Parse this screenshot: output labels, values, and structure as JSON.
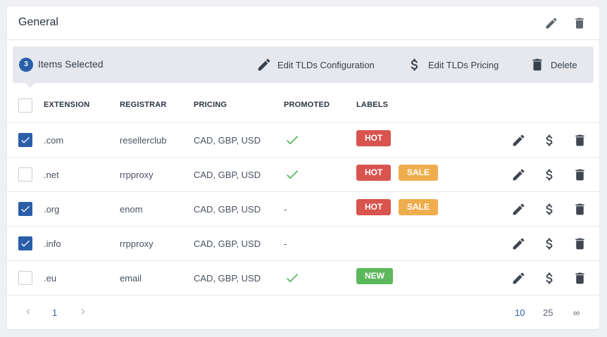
{
  "header": {
    "title": "General"
  },
  "bulk": {
    "count": "3",
    "label": "Items Selected",
    "edit_config": "Edit TLDs Configuration",
    "edit_pricing": "Edit TLDs Pricing",
    "delete": "Delete"
  },
  "columns": {
    "extension": "EXTENSION",
    "registrar": "REGISTRAR",
    "pricing": "PRICING",
    "promoted": "PROMOTED",
    "labels": "LABELS"
  },
  "rows": [
    {
      "extension": ".com",
      "registrar": "resellerclub",
      "pricing": "CAD, GBP, USD",
      "promoted": true,
      "checked": true,
      "labels": [
        "HOT"
      ]
    },
    {
      "extension": ".net",
      "registrar": "rrpproxy",
      "pricing": "CAD, GBP, USD",
      "promoted": true,
      "checked": false,
      "labels": [
        "HOT",
        "SALE"
      ]
    },
    {
      "extension": ".org",
      "registrar": "enom",
      "pricing": "CAD, GBP, USD",
      "promoted": false,
      "promoted_text": "-",
      "checked": true,
      "labels": [
        "HOT",
        "SALE"
      ]
    },
    {
      "extension": ".info",
      "registrar": "rrpproxy",
      "pricing": "CAD, GBP, USD",
      "promoted": false,
      "promoted_text": "-",
      "checked": true,
      "labels": []
    },
    {
      "extension": ".eu",
      "registrar": "email",
      "pricing": "CAD, GBP, USD",
      "promoted": true,
      "checked": false,
      "labels": [
        "NEW"
      ]
    }
  ],
  "label_colors": {
    "HOT": "#d9534f",
    "SALE": "#f0ad4e",
    "NEW": "#5cb85c"
  },
  "colors": {
    "accent": "#2a5ea8",
    "check": "#5cb85c"
  },
  "pagination": {
    "current_page": "1",
    "page_sizes": [
      "10",
      "25",
      "∞"
    ],
    "selected_page_size": "10"
  }
}
